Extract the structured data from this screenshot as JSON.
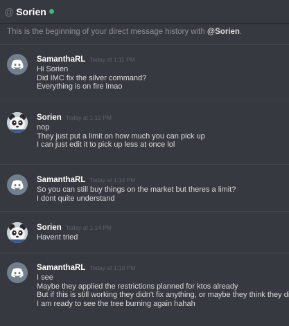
{
  "header": {
    "at": "@",
    "username": "Sorien",
    "status_color": "#43b581"
  },
  "intro": {
    "prefix": "This is the beginning of your direct message history with ",
    "mention": "@Sorien",
    "suffix": "."
  },
  "messages": [
    {
      "author": "SamanthaRL",
      "timestamp": "Today at 1:11 PM",
      "avatar": "discord-default-avatar",
      "lines": [
        "Hi Sorien",
        "Did IMC fix the silver command?",
        "Everything is on fire lmao"
      ]
    },
    {
      "author": "Sorien",
      "timestamp": "Today at 1:12 PM",
      "avatar": "panda-avatar",
      "lines": [
        "nop",
        "They just put a limit on how much you can pick up",
        "I can just edit it to pick up less at once lol"
      ]
    },
    {
      "author": "SamanthaRL",
      "timestamp": "Today at 1:14 PM",
      "avatar": "discord-default-avatar",
      "lines": [
        "So you can still buy things on the market but theres a limit?",
        "I dont quite understand"
      ]
    },
    {
      "author": "Sorien",
      "timestamp": "Today at 1:14 PM",
      "avatar": "panda-avatar",
      "lines": [
        "Havent tried"
      ]
    },
    {
      "author": "SamanthaRL",
      "timestamp": "Today at 1:19 PM",
      "avatar": "discord-default-avatar",
      "lines": [
        "I see",
        "Maybe they applied the restrictions planned for ktos already",
        "But if this is still working they didn't fix anything, or maybe they think they did.",
        "I am ready to see the tree burning again hahah"
      ]
    }
  ]
}
